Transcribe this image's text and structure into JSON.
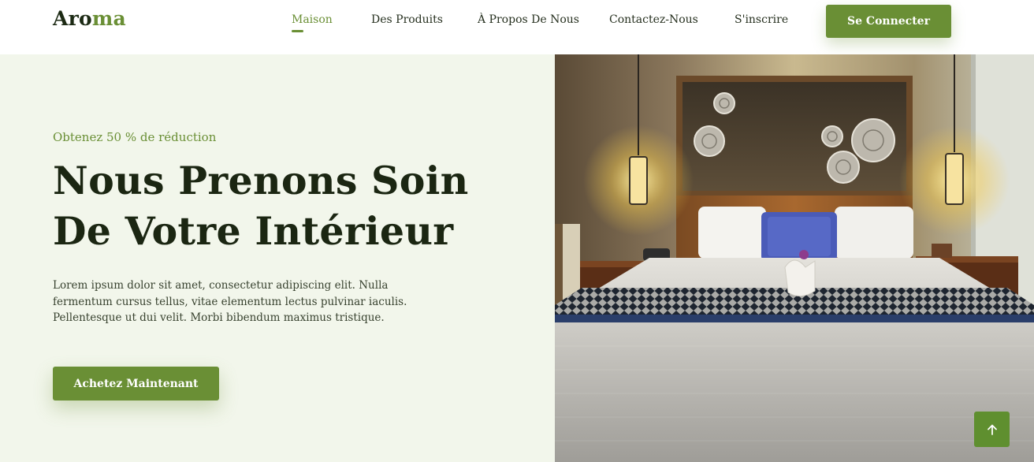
{
  "brand": {
    "logo_part1": "Aro",
    "logo_part2": "ma",
    "accent_color": "#6a8f35"
  },
  "nav": {
    "items": [
      {
        "label": "Maison",
        "active": true
      },
      {
        "label": "Des Produits",
        "active": false
      },
      {
        "label": "À Propos De Nous",
        "active": false
      },
      {
        "label": "Contactez-Nous",
        "active": false
      },
      {
        "label": "S'inscrire",
        "active": false
      }
    ],
    "login_label": "Se Connecter"
  },
  "hero": {
    "discount": "Obtenez 50 % de réduction",
    "title_line1": "Nous Prenons Soin",
    "title_line2": "De Votre Intérieur",
    "description": "Lorem ipsum dolor sit amet, consectetur adipiscing elit. Nulla fermentum cursus tellus, vitae elementum lectus pulvinar iaculis. Pellentesque ut dui velit. Morbi bibendum maximus tristique.",
    "cta_label": "Achetez Maintenant",
    "image_subject": "hotel-bedroom"
  },
  "scroll_top": {
    "icon": "arrow-up-icon"
  }
}
